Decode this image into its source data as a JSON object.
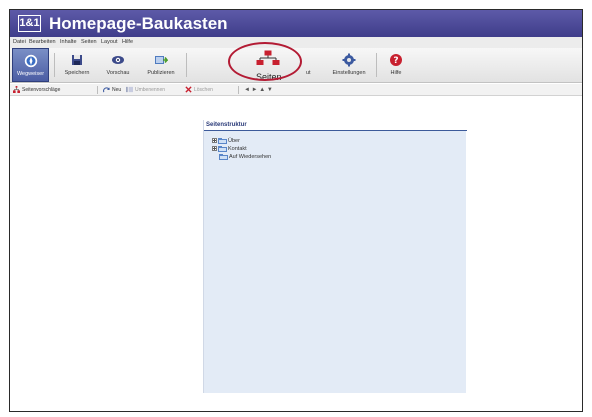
{
  "app": {
    "logo_text": "1&1",
    "title": "Homepage-Baukasten"
  },
  "menu": [
    "Datei",
    "Bearbeiten",
    "Inhalte",
    "Seiten",
    "Layout",
    "Hilfe"
  ],
  "toolbar": {
    "buttons": [
      {
        "label": "Wegweiser",
        "icon": "compass-icon",
        "active": true
      },
      {
        "label": "Speichern",
        "icon": "save-icon"
      },
      {
        "label": "Vorschau",
        "icon": "eye-icon"
      },
      {
        "label": "Publizieren",
        "icon": "publish-icon"
      },
      {
        "label": "Layout",
        "icon": "layout-icon"
      },
      {
        "label": "Einstellungen",
        "icon": "gear-icon"
      },
      {
        "label": "Hilfe",
        "icon": "help-icon"
      }
    ]
  },
  "callout": {
    "label": "Seiten",
    "icon": "sitemap-icon",
    "color": "#b31b34"
  },
  "subtoolbar": {
    "items": [
      {
        "label": "Seitenvorschläge",
        "icon": "sitemap-icon",
        "disabled": false
      },
      {
        "label": "Neu",
        "icon": "new-page-icon",
        "disabled": false
      },
      {
        "label": "Umbenennen",
        "icon": "rename-icon",
        "disabled": true
      },
      {
        "label": "Löschen",
        "icon": "delete-icon",
        "disabled": true
      }
    ],
    "arrows": [
      "◄",
      "►",
      "▲",
      "▼"
    ]
  },
  "panel": {
    "title": "Seitenstruktur",
    "tree": [
      {
        "label": "Über",
        "expandable": true
      },
      {
        "label": "Kontakt",
        "expandable": true
      },
      {
        "label": "Auf Wiedersehen",
        "expandable": false
      }
    ]
  },
  "colors": {
    "titlebar": "#4a479a",
    "panel": "#e3ebf6",
    "accent": "#b31b34"
  }
}
